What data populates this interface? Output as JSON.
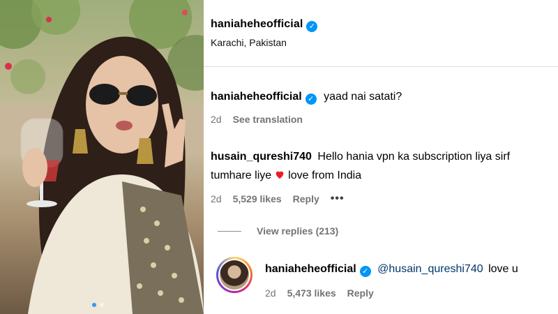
{
  "header": {
    "username": "haniaheheofficial",
    "location": "Karachi, Pakistan"
  },
  "caption": {
    "username": "haniaheheofficial",
    "text": "yaad nai satati?",
    "age": "2d",
    "see_translation": "See translation"
  },
  "comment": {
    "username": "husain_qureshi740",
    "text_line1": "Hello hania vpn ka subscription liya sirf",
    "text_line2a": "tumhare liye",
    "text_line2b": "love from India",
    "age": "2d",
    "likes": "5,529 likes",
    "reply": "Reply",
    "more": "•••",
    "view_replies": "View replies (213)"
  },
  "reply": {
    "username": "haniaheheofficial",
    "mention": "@husain_qureshi740",
    "text": "love u",
    "age": "2d",
    "likes": "5,473 likes",
    "reply": "Reply"
  },
  "colors": {
    "verified": "#0095f6",
    "heart": "#ed1c24",
    "mention": "#00376b",
    "meta_gray": "#737373"
  },
  "icons": {
    "verified": "verified-badge-icon",
    "heart": "heart-icon",
    "more": "more-options-icon"
  }
}
